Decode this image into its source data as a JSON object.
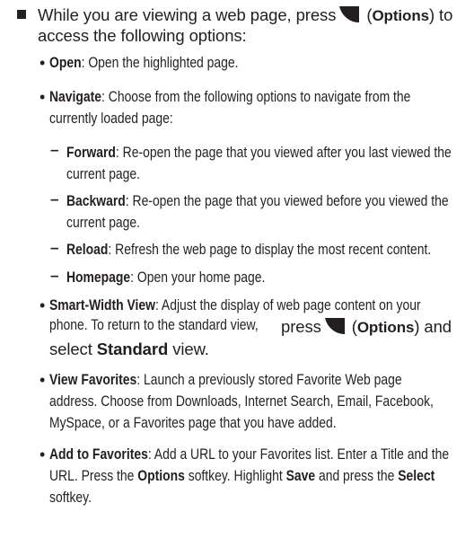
{
  "intro": {
    "line1_a": "While you are viewing a web page, press",
    "line1_b": "(",
    "options": "Options",
    "line1_c": ") to",
    "line2": "access the following options:"
  },
  "items": {
    "open": {
      "term": "Open",
      "desc": ": Open the highlighted page."
    },
    "navigate": {
      "term": "Navigate",
      "desc1": ": Choose from the following options to navigate from the",
      "desc2": "currently loaded page:",
      "forward": {
        "term": "Forward",
        "desc1": ": Re-open the page that you viewed after you last viewed the",
        "desc2": "current page."
      },
      "backward": {
        "term": "Backward",
        "desc1": ": Re-open the page that you viewed before you viewed the",
        "desc2": "current page."
      },
      "reload": {
        "term": "Reload",
        "desc": ": Refresh the web page to display the most recent content."
      },
      "homepage": {
        "term": "Homepage",
        "desc": ": Open your home page."
      }
    },
    "smart": {
      "term": "Smart-Width View",
      "desc1": ": Adjust the display of web page content on your",
      "desc2": "phone. To return to the standard view,",
      "press": "press",
      "open_paren": "(",
      "options": "Options",
      "after": ") and",
      "select": "select",
      "standard": "Standard",
      "view": "view."
    },
    "favorites": {
      "term": "View Favorites",
      "desc1": ": Launch a previously stored Favorite Web page",
      "desc2": "address. Choose from Downloads, Internet Search, Email, Facebook,",
      "desc3": "MySpace, or a Favorites page that you have added."
    },
    "add": {
      "term": "Add to Favorites",
      "desc1": ": Add a URL to your Favorites list. Enter a Title and the",
      "desc2a": "URL. Press the",
      "options": "Options",
      "desc2b": "softkey. Highlight",
      "save": "Save",
      "desc2c": "and press the",
      "select": "Select",
      "desc3": "softkey."
    }
  },
  "markers": {
    "bullet": "•",
    "dash": "–"
  },
  "icons": {
    "softkey": "left-softkey-icon"
  }
}
